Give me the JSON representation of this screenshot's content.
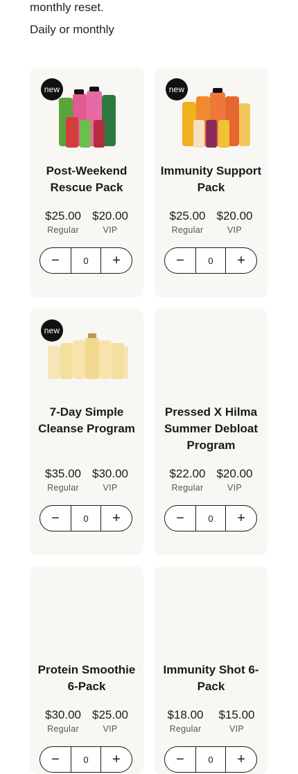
{
  "intro": {
    "line1": "monthly reset.",
    "line2": "Daily or monthly"
  },
  "labels": {
    "regular": "Regular",
    "vip": "VIP",
    "badge": "new"
  },
  "products": [
    {
      "title": "Post-Weekend Rescue Pack",
      "regular": "$25.00",
      "vip": "$20.00",
      "qty": "0",
      "badge": true
    },
    {
      "title": "Immunity Support Pack",
      "regular": "$25.00",
      "vip": "$20.00",
      "qty": "0",
      "badge": true
    },
    {
      "title": "7-Day Simple Cleanse Program",
      "regular": "$35.00",
      "vip": "$30.00",
      "qty": "0",
      "badge": true
    },
    {
      "title": "Pressed X Hilma Summer Debloat Program",
      "regular": "$22.00",
      "vip": "$20.00",
      "qty": "0",
      "badge": false
    },
    {
      "title": "Protein Smoothie 6-Pack",
      "regular": "$30.00",
      "vip": "$25.00",
      "qty": "0",
      "badge": false
    },
    {
      "title": "Immunity Shot 6-Pack",
      "regular": "$18.00",
      "vip": "$15.00",
      "qty": "0",
      "badge": false
    }
  ]
}
